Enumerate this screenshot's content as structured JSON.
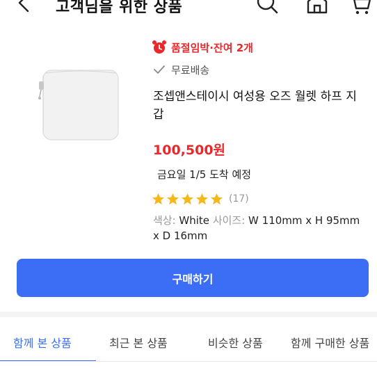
{
  "header": {
    "title": "고객님을 위한 상품",
    "icons": [
      "back-arrow-icon",
      "search-icon",
      "home-icon",
      "cart-icon"
    ]
  },
  "product": {
    "stock_status": "품절임박·잔여 2개",
    "shipping": "무료배송",
    "name": "조셉앤스테이시 여성용 오즈 월렛 하프 지갑",
    "price": "100,500원",
    "arrival": "금요일 1/5 도착 예정",
    "rating_stars": 5,
    "rating_count": "(17)",
    "spec": {
      "color_label": "색상:",
      "color_value": " White ",
      "size_label": "사이즈:",
      "size_value": " W 110mm x H 95mm x D 16mm"
    },
    "image_color": "#f1f1f1"
  },
  "buy_button": {
    "label": "구매하기",
    "color": "#3c6ef5"
  },
  "tabs": [
    {
      "label": "함께 본 상품",
      "active": true
    },
    {
      "label": "최근 본 상품",
      "active": false
    },
    {
      "label": "비슷한 상품",
      "active": false
    },
    {
      "label": "함께 구매한 상품",
      "active": false
    }
  ],
  "colors": {
    "accent": "#3c6ef5",
    "alert": "#e8282b",
    "star": "#f5b81b"
  }
}
